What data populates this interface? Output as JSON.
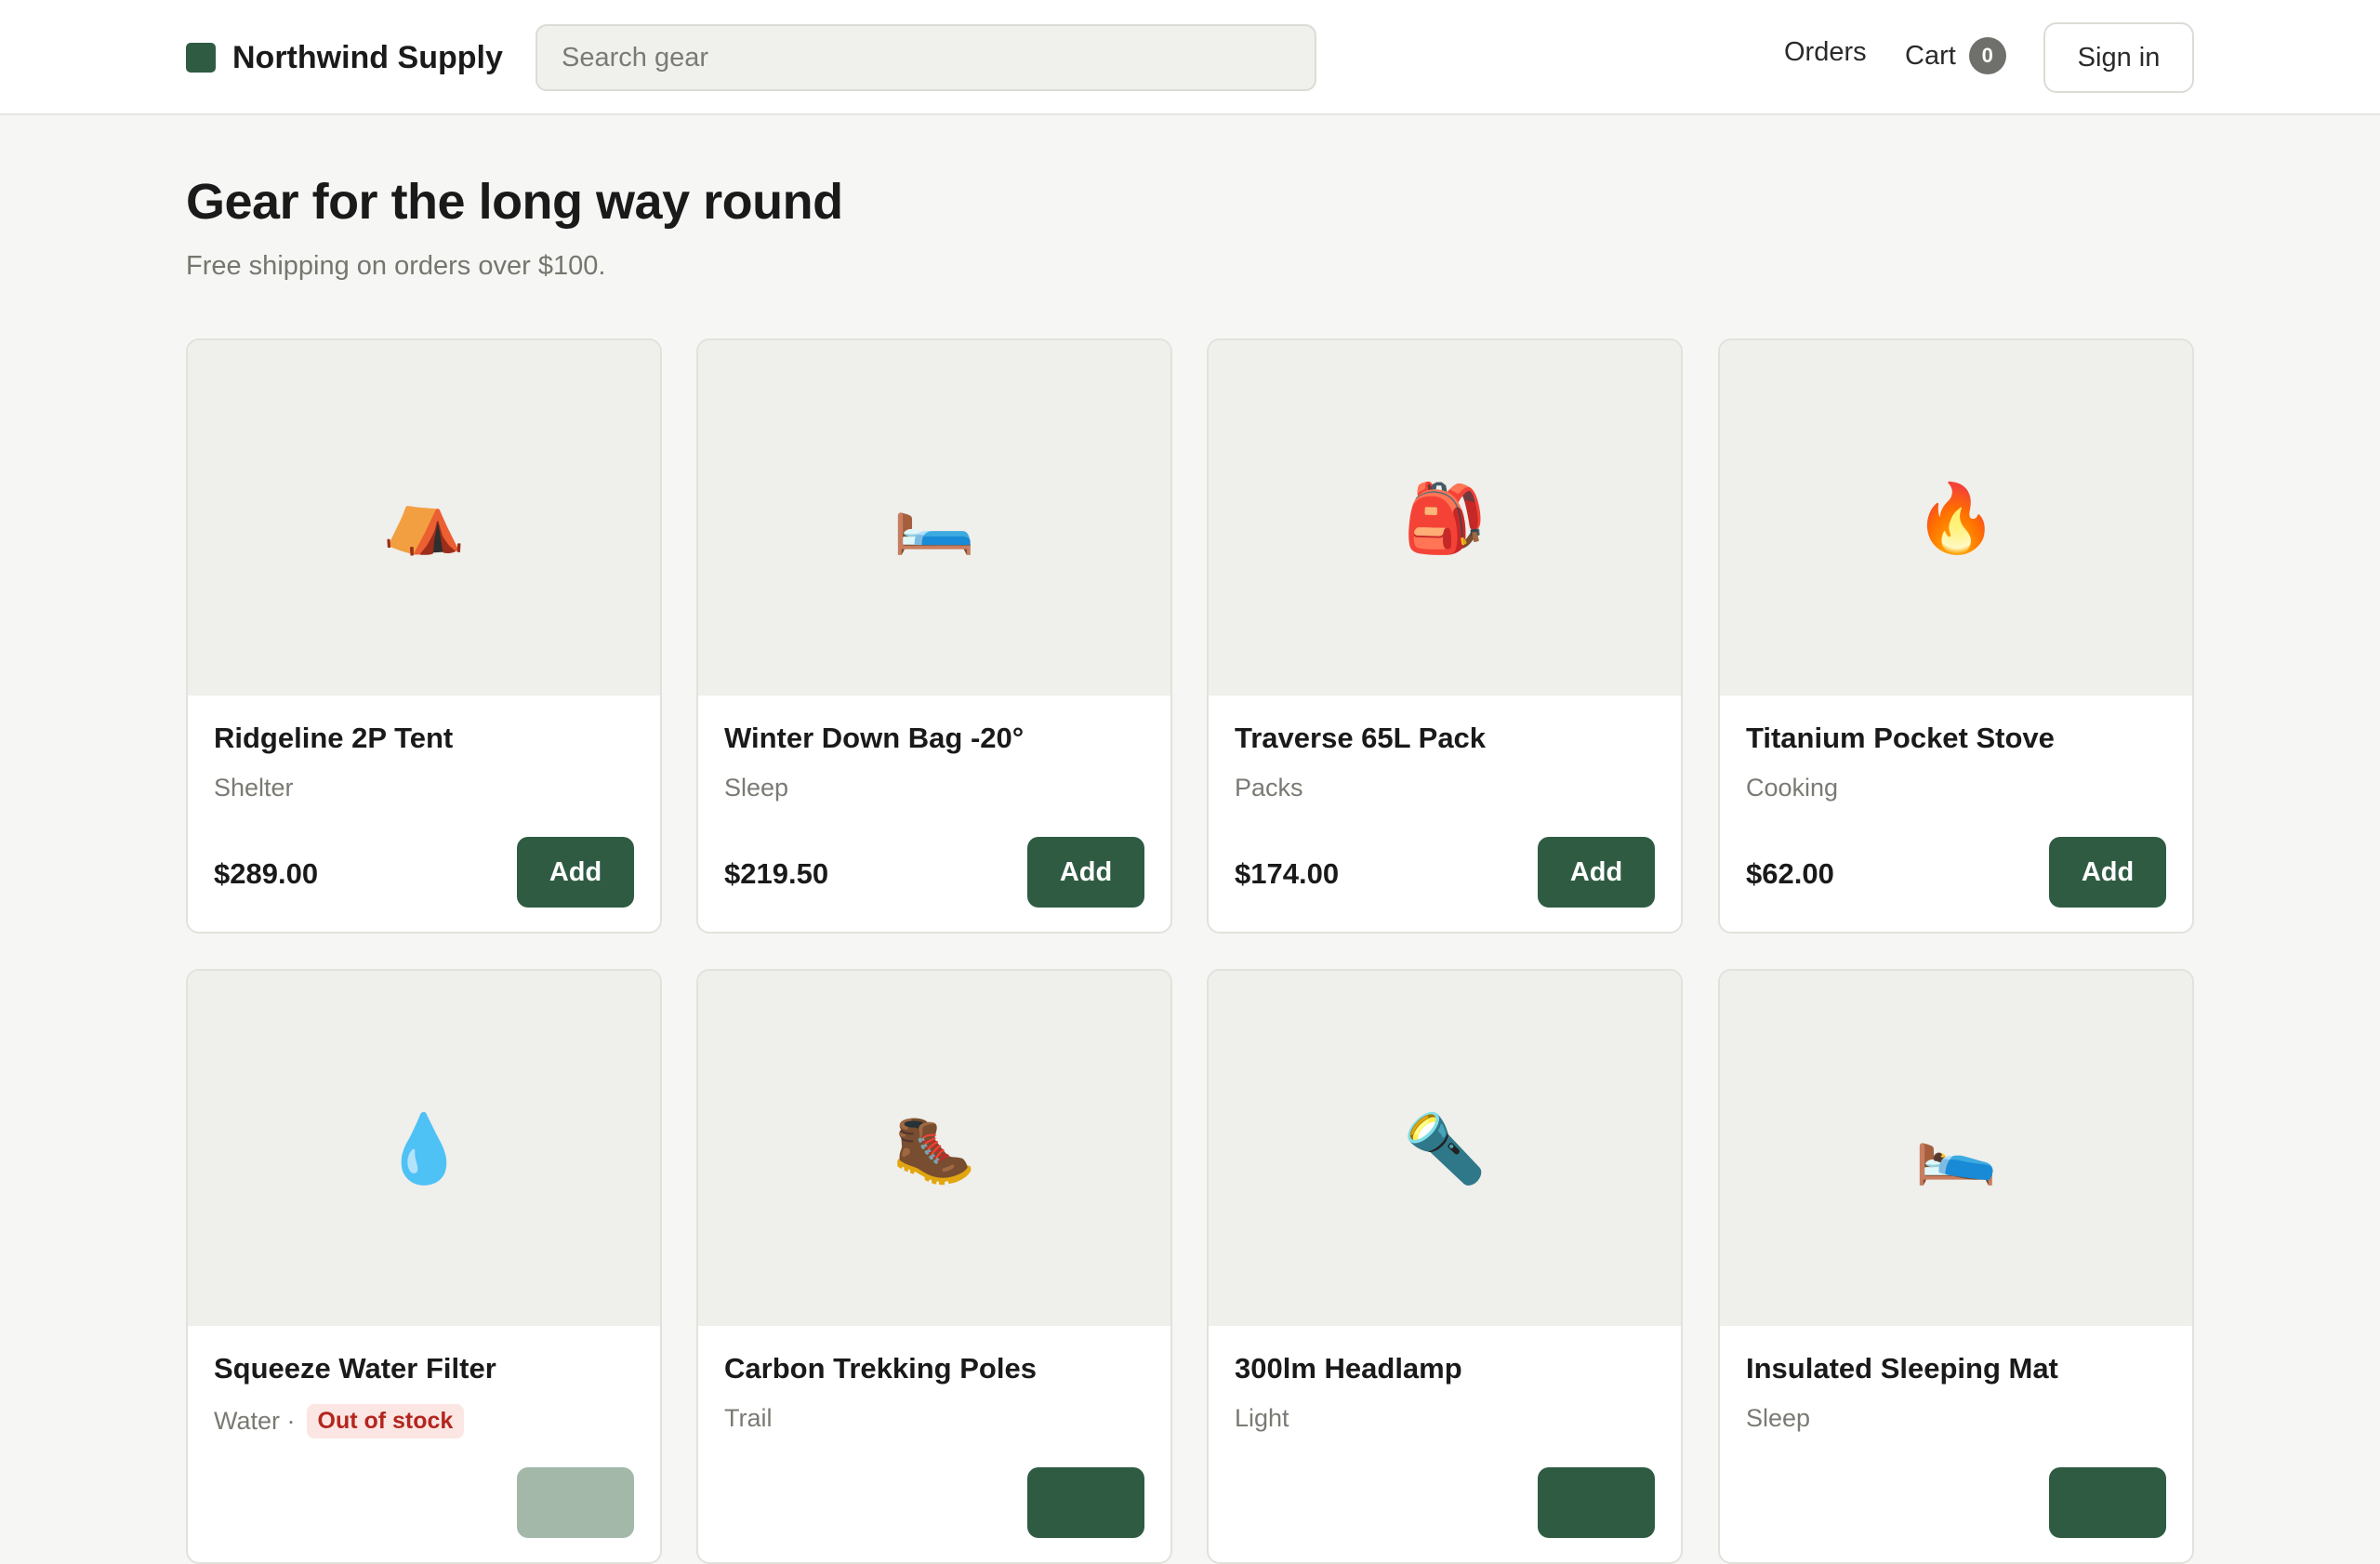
{
  "header": {
    "brand_name": "Northwind Supply",
    "search_placeholder": "Search gear",
    "nav_orders": "Orders",
    "nav_cart": "Cart",
    "cart_count": "0",
    "sign_in": "Sign in"
  },
  "hero": {
    "title": "Gear for the long way round",
    "subtitle": "Free shipping on orders over $100."
  },
  "colors": {
    "brand": "#2f5b43",
    "button_disabled": "#a3b8a9",
    "out_of_stock_text": "#b3261e",
    "out_of_stock_bg": "#fbe6e4"
  },
  "products": [
    {
      "name": "Ridgeline 2P Tent",
      "category": "Shelter",
      "price": "$289.00",
      "add_label": "Add",
      "icon": "tent-icon",
      "glyph": "⛺",
      "in_stock": true
    },
    {
      "name": "Winter Down Bag -20°",
      "category": "Sleep",
      "price": "$219.50",
      "add_label": "Add",
      "icon": "bed-icon",
      "glyph": "🛏️",
      "in_stock": true
    },
    {
      "name": "Traverse 65L Pack",
      "category": "Packs",
      "price": "$174.00",
      "add_label": "Add",
      "icon": "backpack-icon",
      "glyph": "🎒",
      "in_stock": true
    },
    {
      "name": "Titanium Pocket Stove",
      "category": "Cooking",
      "price": "$62.00",
      "add_label": "Add",
      "icon": "fire-icon",
      "glyph": "🔥",
      "in_stock": true
    },
    {
      "name": "Squeeze Water Filter",
      "category": "Water ·",
      "stock_label": "Out of stock",
      "price": "",
      "add_label": "",
      "icon": "droplet-icon",
      "glyph": "💧",
      "in_stock": false
    },
    {
      "name": "Carbon Trekking Poles",
      "category": "Trail",
      "price": "",
      "add_label": "",
      "icon": "hiking-boot-icon",
      "glyph": "🥾",
      "in_stock": true
    },
    {
      "name": "300lm Headlamp",
      "category": "Light",
      "price": "",
      "add_label": "",
      "icon": "flashlight-icon",
      "glyph": "🔦",
      "in_stock": true
    },
    {
      "name": "Insulated Sleeping Mat",
      "category": "Sleep",
      "price": "",
      "add_label": "",
      "icon": "bed-icon",
      "glyph": "🛌",
      "in_stock": true
    }
  ]
}
